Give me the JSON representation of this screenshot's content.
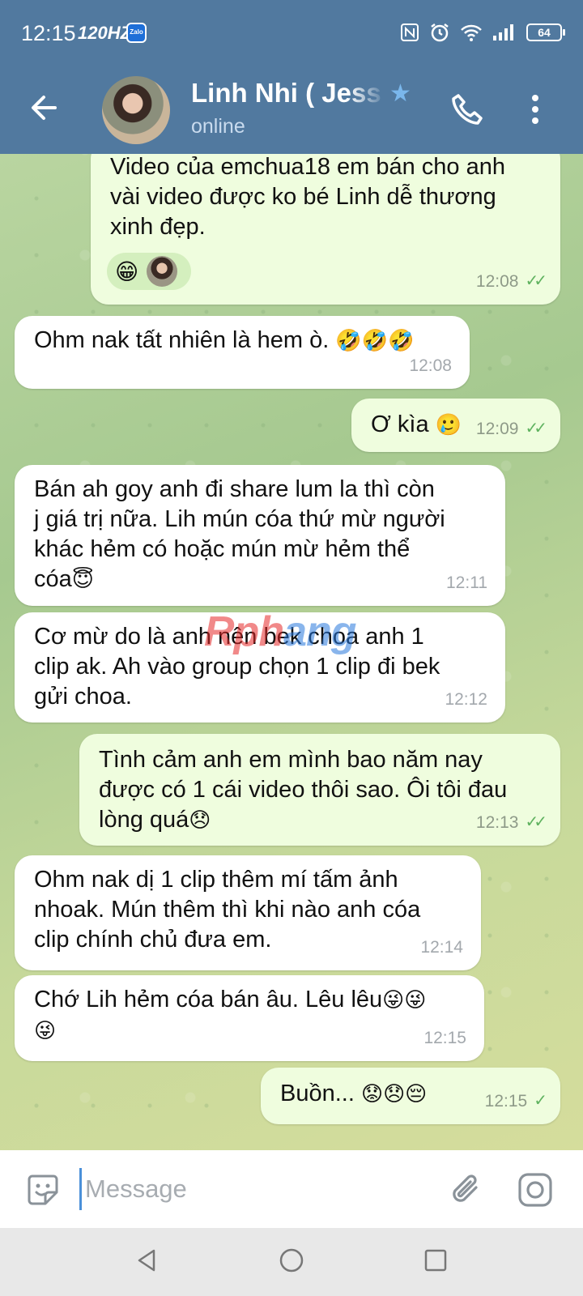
{
  "status_bar": {
    "time": "12:15",
    "refresh_rate": "120HZ",
    "zalo_label": "Zalo",
    "battery": "64"
  },
  "header": {
    "title": "Linh Nhi ( Jess",
    "subtitle": "online"
  },
  "messages": [
    {
      "direction": "out",
      "text_lines": [
        "Video của emchua18 em bán cho anh",
        "vài video được ko bé Linh dễ thương",
        "xinh đẹp."
      ],
      "reaction": "😁",
      "time": "12:08",
      "ticks": "✓✓"
    },
    {
      "direction": "in",
      "text": "Ohm nak tất nhiên là hem ò.",
      "emoji": "🤣🤣🤣",
      "time": "12:08"
    },
    {
      "direction": "out",
      "text": "Ơ kìa",
      "emoji": "🥲",
      "time": "12:09",
      "ticks": "✓✓"
    },
    {
      "direction": "in",
      "text_lines": [
        "Bán ah goy anh đi share lum la thì còn",
        "j giá trị nữa. Lih mún cóa thứ mừ người",
        "khác hẻm có hoặc mún mừ hẻm thể"
      ],
      "last_line": "cóa",
      "emoji": "😇",
      "time": "12:11"
    },
    {
      "direction": "in",
      "text_lines": [
        "Cơ mừ do là anh nên bek choa anh 1",
        "clip ak. Ah vào group chọn 1 clip đi bek",
        "gửi choa."
      ],
      "time": "12:12"
    },
    {
      "direction": "out",
      "text_lines": [
        "Tình cảm anh em mình bao năm nay",
        "được có 1 cái video thôi sao. Ôi tôi đau"
      ],
      "last_line": "lòng quá",
      "emoji": "😞",
      "time": "12:13",
      "ticks": "✓✓"
    },
    {
      "direction": "in",
      "text_lines": [
        "Ohm nak dị 1 clip thêm mí tấm ảnh",
        "nhoak. Mún thêm thì khi nào anh cóa",
        "clip chính chủ đưa em."
      ],
      "time": "12:14"
    },
    {
      "direction": "in",
      "text": "Chớ Lih hẻm cóa bán âu. Lêu lêu",
      "emoji": "😜😜",
      "emoji_line2": "😜",
      "time": "12:15"
    },
    {
      "direction": "out",
      "text": "Buồn...",
      "emoji": "😟😞😔",
      "time": "12:15",
      "ticks": "✓"
    }
  ],
  "watermark": {
    "part_a": "Rph",
    "part_b": "ang"
  },
  "input": {
    "placeholder": "Message"
  },
  "colors": {
    "header": "#51799f",
    "bubble_out": "#effdde",
    "bubble_in": "#ffffff",
    "tick": "#5fb25f"
  },
  "icons": [
    "back-arrow-icon",
    "phone-icon",
    "more-vertical-icon",
    "sticker-icon",
    "attach-icon",
    "camera-icon",
    "nav-back-icon",
    "nav-home-icon",
    "nav-recent-icon",
    "star-icon",
    "nfc-icon",
    "alarm-icon",
    "wifi-icon",
    "signal-icon",
    "battery-icon"
  ]
}
